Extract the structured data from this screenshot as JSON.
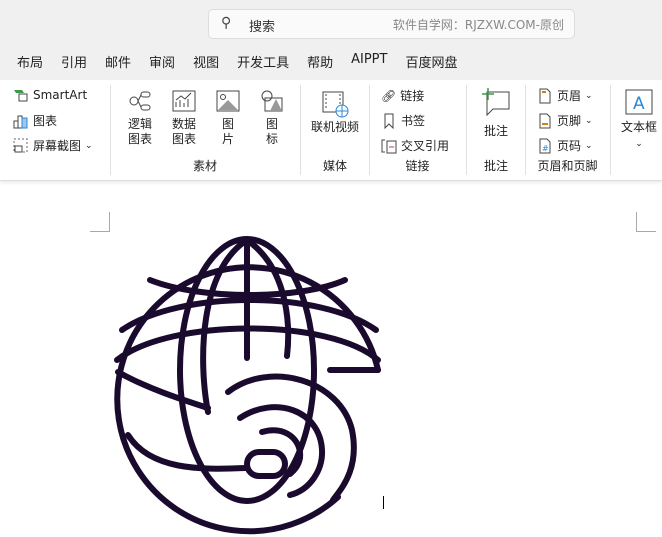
{
  "search": {
    "placeholder": "搜索",
    "hint": "软件自学网：RJZXW.COM-原创"
  },
  "tabs": [
    "布局",
    "引用",
    "邮件",
    "审阅",
    "视图",
    "开发工具",
    "帮助",
    "AIPPT",
    "百度网盘"
  ],
  "ribbon": {
    "smartart": "SmartArt",
    "chart": "图表",
    "screenshot": "屏幕截图",
    "material": {
      "items": [
        "逻辑\n图表",
        "数据\n图表",
        "图\n片",
        "图\n标"
      ],
      "label": "素材"
    },
    "media": {
      "video": "联机视频",
      "label": "媒体"
    },
    "links": {
      "link": "链接",
      "bookmark": "书签",
      "crossref": "交叉引用",
      "label": "链接"
    },
    "comment": {
      "btn": "批注",
      "label": "批注"
    },
    "header_footer": {
      "header": "页眉",
      "footer": "页脚",
      "page_number": "页码",
      "label": "页眉和页脚"
    },
    "textbox": "文本框"
  },
  "colors": {
    "globe": "#1a0b2e",
    "accent": "#2b88d8"
  }
}
